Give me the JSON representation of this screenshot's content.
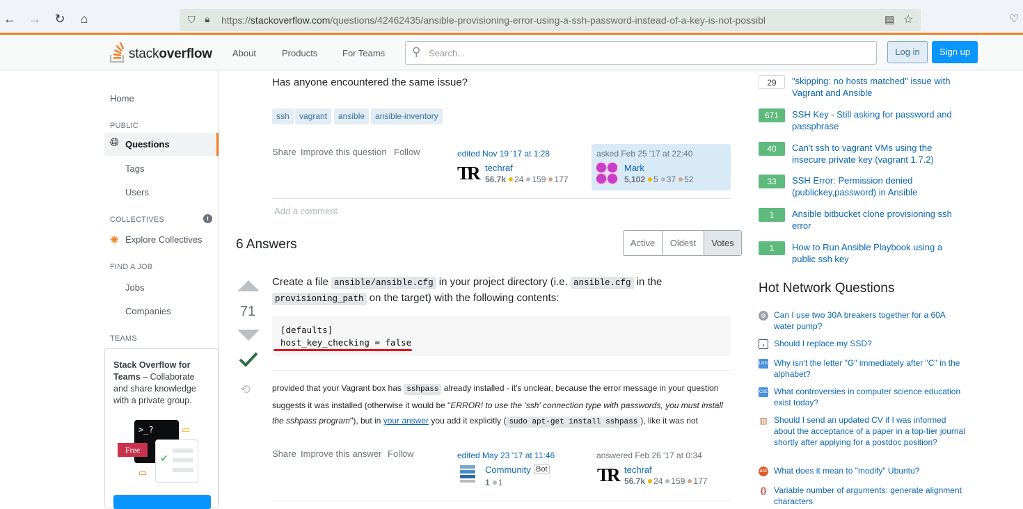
{
  "browser": {
    "url_prefix": "https://",
    "url_host": "stackoverflow.com",
    "url_path": "/questions/42462435/ansible-provisioning-error-using-a-ssh-password-instead-of-a-key-is-not-possibl"
  },
  "topbar": {
    "logo_light": "stack",
    "logo_bold": "overflow",
    "nav": [
      "About",
      "Products",
      "For Teams"
    ],
    "search_placeholder": "Search...",
    "login": "Log in",
    "signup": "Sign up"
  },
  "left_nav": {
    "home": "Home",
    "public_head": "PUBLIC",
    "questions": "Questions",
    "tags": "Tags",
    "users": "Users",
    "collectives_head": "COLLECTIVES",
    "explore_collectives": "Explore Collectives",
    "find_job_head": "FIND A JOB",
    "jobs": "Jobs",
    "companies": "Companies",
    "teams_head": "TEAMS",
    "teams_title": "Stack Overflow for Teams",
    "teams_dash": " – ",
    "teams_desc": "Collaborate and share knowledge with a private group.",
    "teams_free": "Free",
    "teams_prompt": ">_?"
  },
  "question": {
    "last_paragraph": "Has anyone encountered the same issue?",
    "tags": [
      "ssh",
      "vagrant",
      "ansible",
      "ansible-inventory"
    ],
    "menu": [
      "Share",
      "Improve this question",
      "Follow"
    ],
    "edited": {
      "label": "edited Nov 19 '17 at 1:28",
      "user": "techraf",
      "rep": "56.7k",
      "gold": "24",
      "silver": "159",
      "bronze": "177"
    },
    "asked": {
      "label": "asked Feb 25 '17 at 22:40",
      "user": "Mark",
      "rep": "5,102",
      "gold": "5",
      "silver": "37",
      "bronze": "52"
    },
    "add_comment": "Add a comment"
  },
  "answers_header": {
    "count_label": "6 Answers",
    "sort": [
      "Active",
      "Oldest",
      "Votes"
    ],
    "selected_sort": "Votes"
  },
  "answer": {
    "votes": "71",
    "p1": {
      "t1": "Create a file ",
      "c1": "ansible/ansible.cfg",
      "t2": " in your project directory (i.e. ",
      "c2": "ansible.cfg",
      "t3": " in the ",
      "c3": "provisioning_path",
      "t4": " on the target) with the following contents:"
    },
    "code_line1": "[defaults]",
    "code_line2": "host_key_checking = false",
    "p2": {
      "t1": "provided that your Vagrant box has ",
      "c1": "sshpass",
      "t2": " already installed - it's unclear, because the error message in your question suggests it was installed (otherwise it would be \"",
      "em": "ERROR! to use the 'ssh' connection type with passwords, you must install the sshpass program",
      "t3": "\"), but in ",
      "link": "your answer",
      "t4": " you add it explicitly (",
      "c2": "sudo apt-get install sshpass",
      "t5": "), like it was not"
    },
    "menu": [
      "Share",
      "Improve this answer",
      "Follow"
    ],
    "edited": {
      "label": "edited May 23 '17 at 11:46",
      "user": "Community",
      "bot": "Bot",
      "rep": "1",
      "silver": "1"
    },
    "answered": {
      "label": "answered Feb 26 '17 at 0:34",
      "user": "techraf",
      "rep": "56.7k",
      "gold": "24",
      "silver": "159",
      "bronze": "177"
    }
  },
  "related": [
    {
      "score": "29",
      "accepted": false,
      "title": "\"skipping: no hosts matched\" issue with Vagrant and Ansible"
    },
    {
      "score": "671",
      "accepted": true,
      "title": "SSH Key - Still asking for password and passphrase"
    },
    {
      "score": "40",
      "accepted": true,
      "title": "Can't ssh to vagrant VMs using the insecure private key (vagrant 1.7.2)"
    },
    {
      "score": "33",
      "accepted": true,
      "title": "SSH Error: Permission denied (publickey,password) in Ansible"
    },
    {
      "score": "1",
      "accepted": true,
      "title": "Ansible bitbucket clone provisioning ssh error"
    },
    {
      "score": "1",
      "accepted": true,
      "title": "How to Run Ansible Playbook using a public ssh key"
    }
  ],
  "hnq": {
    "title": "Hot Network Questions",
    "items": [
      {
        "icon": "diy-icon",
        "color": "#9aa0a6",
        "title": "Can I use two 30A breakers together for a 60A water pump?"
      },
      {
        "icon": "superuser-icon",
        "color": "#2b4b6b",
        "title": "Should I replace my SSD?"
      },
      {
        "icon": "ell-icon",
        "color": "#4a90d9",
        "title": "Why isn't the letter \"G\" immediately after \"C\" in the alphabet?"
      },
      {
        "icon": "cseducators-icon",
        "color": "#4a90d9",
        "title": "What controversies in computer science education exist today?"
      },
      {
        "icon": "academia-icon",
        "color": "#c07b4a",
        "title": "Should I send an updated CV if I was informed about the acceptance of a paper in a top-tier journal shortly after applying for a postdoc position?"
      },
      {
        "icon": "askubuntu-icon",
        "color": "#e05a28",
        "title": "What does it mean to \"modify\" Ubuntu?"
      },
      {
        "icon": "tex-icon",
        "color": "#c0392b",
        "title": "Variable number of arguments: generate alignment characters"
      }
    ]
  }
}
